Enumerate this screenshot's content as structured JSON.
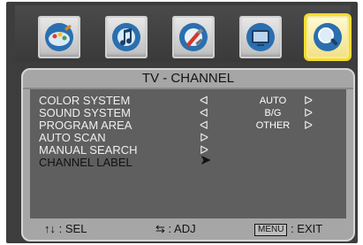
{
  "menu_icons": [
    {
      "name": "picture-icon",
      "active": false
    },
    {
      "name": "sound-icon",
      "active": false
    },
    {
      "name": "setup-icon",
      "active": false
    },
    {
      "name": "tv-icon",
      "active": false
    },
    {
      "name": "search-icon",
      "active": true
    }
  ],
  "panel": {
    "title": "TV - CHANNEL",
    "rows": [
      {
        "label": "COLOR SYSTEM",
        "left_arrow": "ᐊ",
        "value": "AUTO",
        "right_arrow": "ᐅ"
      },
      {
        "label": "SOUND SYSTEM",
        "left_arrow": "ᐊ",
        "value": "B/G",
        "right_arrow": "ᐅ"
      },
      {
        "label": "PROGRAM AREA",
        "left_arrow": "ᐊ",
        "value": "OTHER",
        "right_arrow": "ᐅ"
      },
      {
        "label": "AUTO SCAN",
        "left_arrow": "ᐅ"
      },
      {
        "label": "MANUAL SEARCH",
        "left_arrow": "ᐅ"
      },
      {
        "label": "CHANNEL LABEL",
        "left_arrow": "➤"
      }
    ]
  },
  "hints": {
    "sel_keys": "↑↓",
    "sel_label": ": SEL",
    "adj_keys": "⇆",
    "adj_label": ": ADJ",
    "menu_key": "MENU",
    "exit_label": ": EXIT"
  }
}
